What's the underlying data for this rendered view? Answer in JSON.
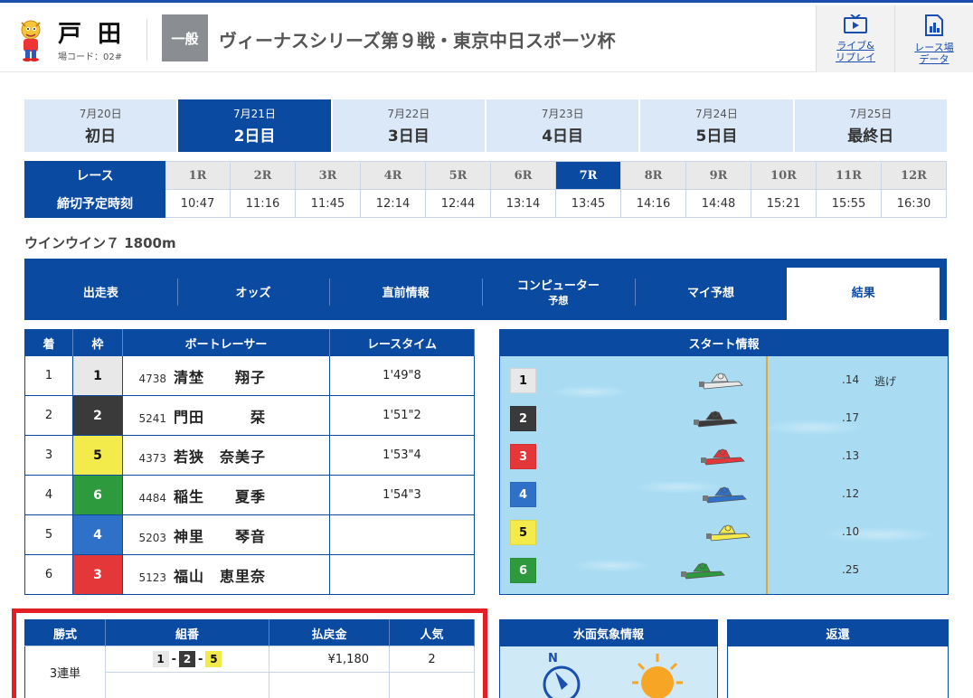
{
  "header": {
    "stadium_name": "戸田",
    "stadium_code": "場コード：02#",
    "grade": "一般",
    "race_title": "ヴィーナスシリーズ第９戦・東京中日スポーツ杯",
    "live_link": "ライブ&\nリプレイ",
    "data_link": "レース場\nデータ",
    "accent_color": "#0b4aa1"
  },
  "days": [
    {
      "date": "7月20日",
      "label": "初日"
    },
    {
      "date": "7月21日",
      "label": "2日目"
    },
    {
      "date": "7月22日",
      "label": "3日目"
    },
    {
      "date": "7月23日",
      "label": "4日目"
    },
    {
      "date": "7月24日",
      "label": "5日目"
    },
    {
      "date": "7月25日",
      "label": "最終日"
    }
  ],
  "active_day": 1,
  "races": {
    "header_race": "レース",
    "header_time": "締切予定時刻",
    "numbers": [
      "1R",
      "2R",
      "3R",
      "4R",
      "5R",
      "6R",
      "7R",
      "8R",
      "9R",
      "10R",
      "11R",
      "12R"
    ],
    "times": [
      "10:47",
      "11:16",
      "11:45",
      "12:14",
      "12:44",
      "13:14",
      "13:45",
      "14:16",
      "14:48",
      "15:21",
      "15:55",
      "16:30"
    ],
    "active": 6
  },
  "race_subtitle": "ウインウイン７ 1800m",
  "nav_tabs": [
    {
      "label": "出走表",
      "sub": ""
    },
    {
      "label": "オッズ",
      "sub": ""
    },
    {
      "label": "直前情報",
      "sub": ""
    },
    {
      "label": "コンピューター",
      "sub": "予想"
    },
    {
      "label": "マイ予想",
      "sub": ""
    },
    {
      "label": "結果",
      "sub": ""
    }
  ],
  "result_table": {
    "headers": [
      "着",
      "枠",
      "ボートレーサー",
      "レースタイム"
    ],
    "rows": [
      {
        "place": "1",
        "frame": "1",
        "reg": "4738",
        "name": "清埜　　翔子",
        "time": "1'49\"8"
      },
      {
        "place": "2",
        "frame": "2",
        "reg": "5241",
        "name": "門田　　　栞",
        "time": "1'51\"2"
      },
      {
        "place": "3",
        "frame": "5",
        "reg": "4373",
        "name": "若狭　奈美子",
        "time": "1'53\"4"
      },
      {
        "place": "4",
        "frame": "6",
        "reg": "4484",
        "name": "稲生　　夏季",
        "time": "1'54\"3"
      },
      {
        "place": "5",
        "frame": "4",
        "reg": "5203",
        "name": "神里　　琴音",
        "time": ""
      },
      {
        "place": "6",
        "frame": "3",
        "reg": "5123",
        "name": "福山　恵里奈",
        "time": ""
      }
    ]
  },
  "start_info": {
    "title": "スタート情報",
    "rows": [
      {
        "frame": "1",
        "st": ".14",
        "tech": "逃げ"
      },
      {
        "frame": "2",
        "st": ".17",
        "tech": ""
      },
      {
        "frame": "3",
        "st": ".13",
        "tech": ""
      },
      {
        "frame": "4",
        "st": ".12",
        "tech": ""
      },
      {
        "frame": "5",
        "st": ".10",
        "tech": ""
      },
      {
        "frame": "6",
        "st": ".25",
        "tech": ""
      }
    ]
  },
  "payout": {
    "headers": [
      "勝式",
      "組番",
      "払戻金",
      "人気"
    ],
    "bet_type": "3連単",
    "combo": [
      "1",
      "2",
      "5"
    ],
    "amount": "¥1,180",
    "popularity": "2"
  },
  "weather": {
    "title": "水面気象情報",
    "north": "N"
  },
  "refund": {
    "title": "返還"
  },
  "frame_colors": {
    "1": "#e8e8e8",
    "2": "#3a3a3a",
    "3": "#e4373a",
    "4": "#2f71c8",
    "5": "#f3ea4b",
    "6": "#2e9a3e"
  }
}
